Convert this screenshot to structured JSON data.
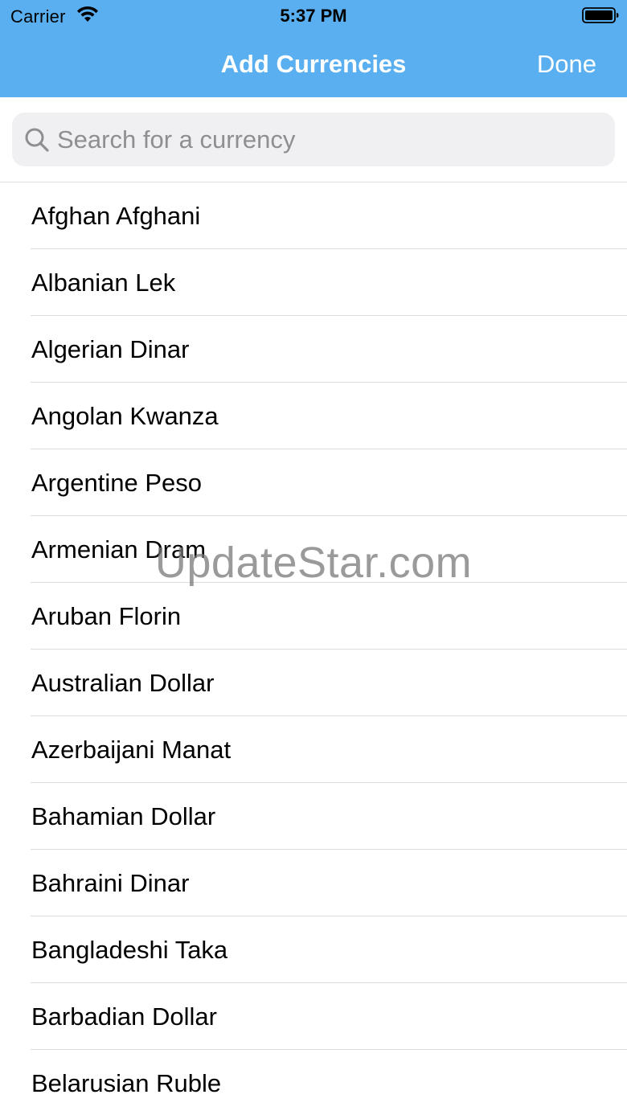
{
  "status_bar": {
    "carrier": "Carrier",
    "time": "5:37 PM",
    "wifi_icon": "wifi-icon",
    "battery_icon": "battery-full-icon"
  },
  "nav": {
    "title": "Add Currencies",
    "done_label": "Done",
    "background_color": "#5aaff0"
  },
  "search": {
    "placeholder": "Search for a currency",
    "value": "",
    "icon": "search-icon"
  },
  "currencies": [
    "Afghan Afghani",
    "Albanian Lek",
    "Algerian Dinar",
    "Angolan Kwanza",
    "Argentine Peso",
    "Armenian Dram",
    "Aruban Florin",
    "Australian Dollar",
    "Azerbaijani Manat",
    "Bahamian Dollar",
    "Bahraini Dinar",
    "Bangladeshi Taka",
    "Barbadian Dollar",
    "Belarusian Ruble"
  ],
  "watermark": "UpdateStar.com"
}
